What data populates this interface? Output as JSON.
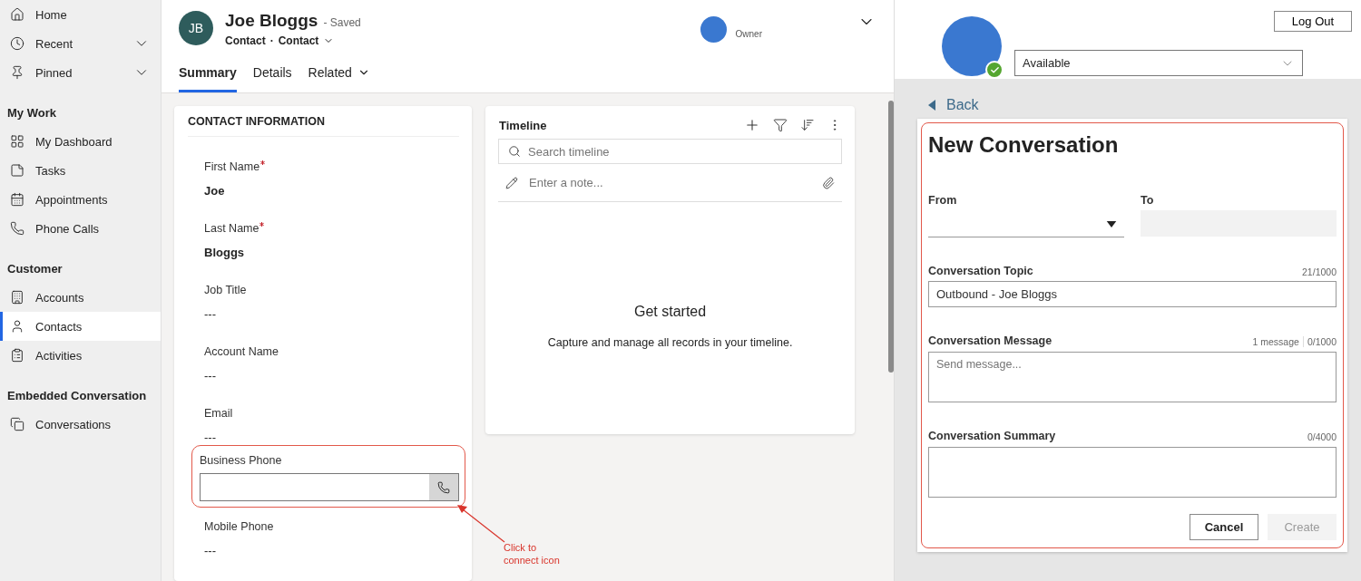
{
  "sidebar": {
    "sections": [
      {
        "items": [
          {
            "label": "Home",
            "expandable": false,
            "selected": false
          },
          {
            "label": "Recent",
            "expandable": true,
            "selected": false
          },
          {
            "label": "Pinned",
            "expandable": true,
            "selected": false
          }
        ]
      },
      {
        "title": "My Work",
        "items": [
          {
            "label": "My Dashboard",
            "expandable": false,
            "selected": false
          },
          {
            "label": "Tasks",
            "expandable": false,
            "selected": false
          },
          {
            "label": "Appointments",
            "expandable": false,
            "selected": false
          },
          {
            "label": "Phone Calls",
            "expandable": false,
            "selected": false
          }
        ]
      },
      {
        "title": "Customer",
        "items": [
          {
            "label": "Accounts",
            "expandable": false,
            "selected": false
          },
          {
            "label": "Contacts",
            "expandable": false,
            "selected": true
          },
          {
            "label": "Activities",
            "expandable": false,
            "selected": false
          }
        ]
      },
      {
        "title": "Embedded Conversation",
        "items": [
          {
            "label": "Conversations",
            "expandable": false,
            "selected": false
          }
        ]
      }
    ]
  },
  "record": {
    "initials": "JB",
    "name": "Joe Bloggs",
    "status": "- Saved",
    "entity": "Contact",
    "separator": "·",
    "form": "Contact",
    "owner_label": "Owner"
  },
  "tabs": [
    {
      "label": "Summary",
      "selected": true,
      "dropdown": false
    },
    {
      "label": "Details",
      "selected": false,
      "dropdown": false
    },
    {
      "label": "Related",
      "selected": false,
      "dropdown": true
    }
  ],
  "contact_information": {
    "title": "CONTACT INFORMATION",
    "fields": [
      {
        "kind": "text",
        "label": "First Name",
        "required": true,
        "value": "Joe"
      },
      {
        "kind": "text",
        "label": "Last Name",
        "required": true,
        "value": "Bloggs"
      },
      {
        "kind": "text",
        "label": "Job Title",
        "required": false,
        "value": "---"
      },
      {
        "kind": "text",
        "label": "Account Name",
        "required": false,
        "value": "---"
      },
      {
        "kind": "text",
        "label": "Email",
        "required": false,
        "value": "---"
      },
      {
        "kind": "phone",
        "label": "Business Phone",
        "required": false
      },
      {
        "kind": "text",
        "label": "Mobile Phone",
        "required": false,
        "value": "---"
      }
    ]
  },
  "timeline": {
    "title": "Timeline",
    "search_placeholder": "Search timeline",
    "note_placeholder": "Enter a note...",
    "empty_title": "Get started",
    "empty_text": "Capture and manage all records in your timeline."
  },
  "annotation": {
    "text": "Click to connect icon"
  },
  "agent_panel": {
    "presence": "Available",
    "logout": "Log Out",
    "back": "Back",
    "form": {
      "title": "New Conversation",
      "from_label": "From",
      "to_label": "To",
      "topic": {
        "label": "Conversation Topic",
        "counter": "21/1000",
        "value": "Outbound - Joe Bloggs"
      },
      "message": {
        "label": "Conversation Message",
        "count": "1 message",
        "counter": "0/1000",
        "placeholder": "Send message..."
      },
      "summary": {
        "label": "Conversation Summary",
        "counter": "0/4000"
      },
      "buttons": [
        {
          "label": "Cancel",
          "disabled": false
        },
        {
          "label": "Create",
          "disabled": true
        }
      ]
    }
  }
}
